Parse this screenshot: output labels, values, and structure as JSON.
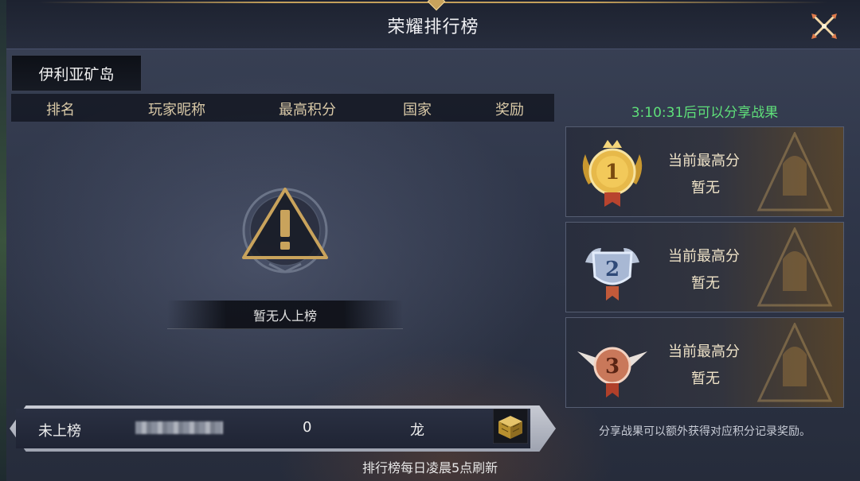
{
  "window": {
    "title": "荣耀排行榜",
    "close_icon": "crossed-swords-close-icon"
  },
  "tabs": [
    {
      "label": "伊利亚矿岛",
      "selected": true
    }
  ],
  "table": {
    "columns": [
      "排名",
      "玩家昵称",
      "最高积分",
      "国家",
      "奖励"
    ]
  },
  "empty_state": {
    "icon": "warning-triangle-icon",
    "message": "暂无人上榜"
  },
  "my_entry": {
    "rank": "未上榜",
    "name_hidden": true,
    "score": "0",
    "country": "龙",
    "reward_icon": "treasure-chest-icon"
  },
  "refresh_note": "排行榜每日凌晨5点刷新",
  "share": {
    "countdown": "3:10:31后可以分享战果",
    "hint": "分享战果可以额外获得对应积分记录奖励。"
  },
  "rewards": [
    {
      "place": "1",
      "title": "当前最高分",
      "value": "暂无",
      "medal_icon": "gold-medal-icon"
    },
    {
      "place": "2",
      "title": "当前最高分",
      "value": "暂无",
      "medal_icon": "silver-medal-icon"
    },
    {
      "place": "3",
      "title": "当前最高分",
      "value": "暂无",
      "medal_icon": "bronze-medal-icon"
    }
  ],
  "colors": {
    "accent_gold": "#c9a35c",
    "countdown_green": "#5fe07a",
    "header_text": "#d9c9a7"
  }
}
